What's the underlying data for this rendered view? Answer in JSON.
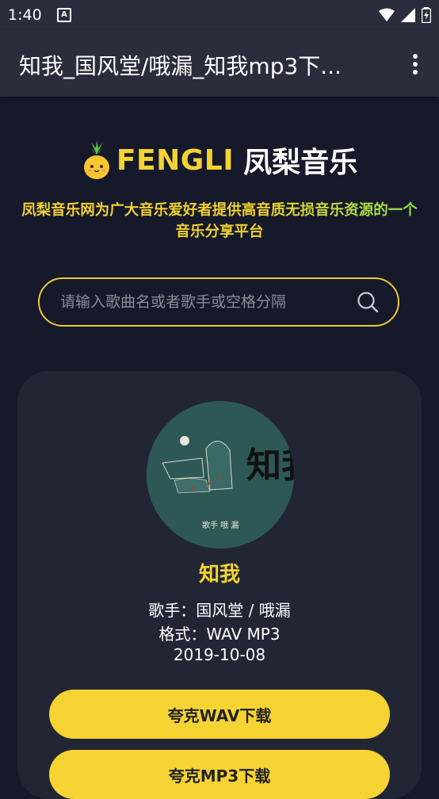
{
  "status": {
    "time": "1:40",
    "a_icon": "A"
  },
  "appbar": {
    "title": "知我_国风堂/哦漏_知我mp3下..."
  },
  "header": {
    "logo_en": "FENGLI",
    "logo_cn": "凤梨音乐",
    "tagline": "凤梨音乐网为广大音乐爱好者提供高音质无损音乐资源的一个音乐分享平台"
  },
  "search": {
    "placeholder": "请输入歌曲名或者歌手或空格分隔"
  },
  "song": {
    "cover_text": "知我",
    "cover_artist": "歌手 哦 漏",
    "title": "知我",
    "artist": "歌手：国风堂 / 哦漏",
    "format": "格式：WAV MP3",
    "date": "2019-10-08"
  },
  "buttons": {
    "wav": "夸克WAV下载",
    "mp3": "夸克MP3下载"
  },
  "colors": {
    "accent": "#f5d332",
    "background": "#15192a",
    "card": "#222634",
    "appbar": "#2a2e3c"
  }
}
